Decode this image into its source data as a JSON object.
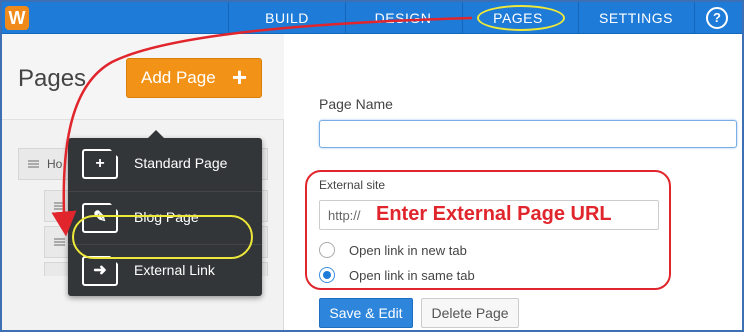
{
  "nav": {
    "logo": "W",
    "build": "BUILD",
    "design": "DESIGN",
    "pages": "PAGES",
    "settings": "SETTINGS",
    "help": "?"
  },
  "sidebar": {
    "title": "Pages",
    "add_page_label": "Add Page",
    "add_page_plus": "+",
    "rows": [
      "Ho"
    ]
  },
  "menu": {
    "items": [
      {
        "label": "Standard Page",
        "icon": "plus-page-icon",
        "glyph": "+"
      },
      {
        "label": "Blog Page",
        "icon": "pencil-page-icon",
        "glyph": "✎"
      },
      {
        "label": "External Link",
        "icon": "arrow-page-icon",
        "glyph": "➜"
      }
    ]
  },
  "form": {
    "page_name_label": "Page Name",
    "page_name_value": "",
    "external_label": "External site",
    "url_prefix": "http://",
    "url_hint": "Enter External Page URL",
    "radio_new_tab": "Open link in new tab",
    "radio_same_tab": "Open link in same tab",
    "selected_radio": "same_tab",
    "save_label": "Save & Edit",
    "delete_label": "Delete Page"
  },
  "colors": {
    "nav_blue": "#1f7bd8",
    "accent_orange": "#f29318",
    "annotation_red": "#e1252c",
    "annotation_yellow": "#ede83a"
  }
}
